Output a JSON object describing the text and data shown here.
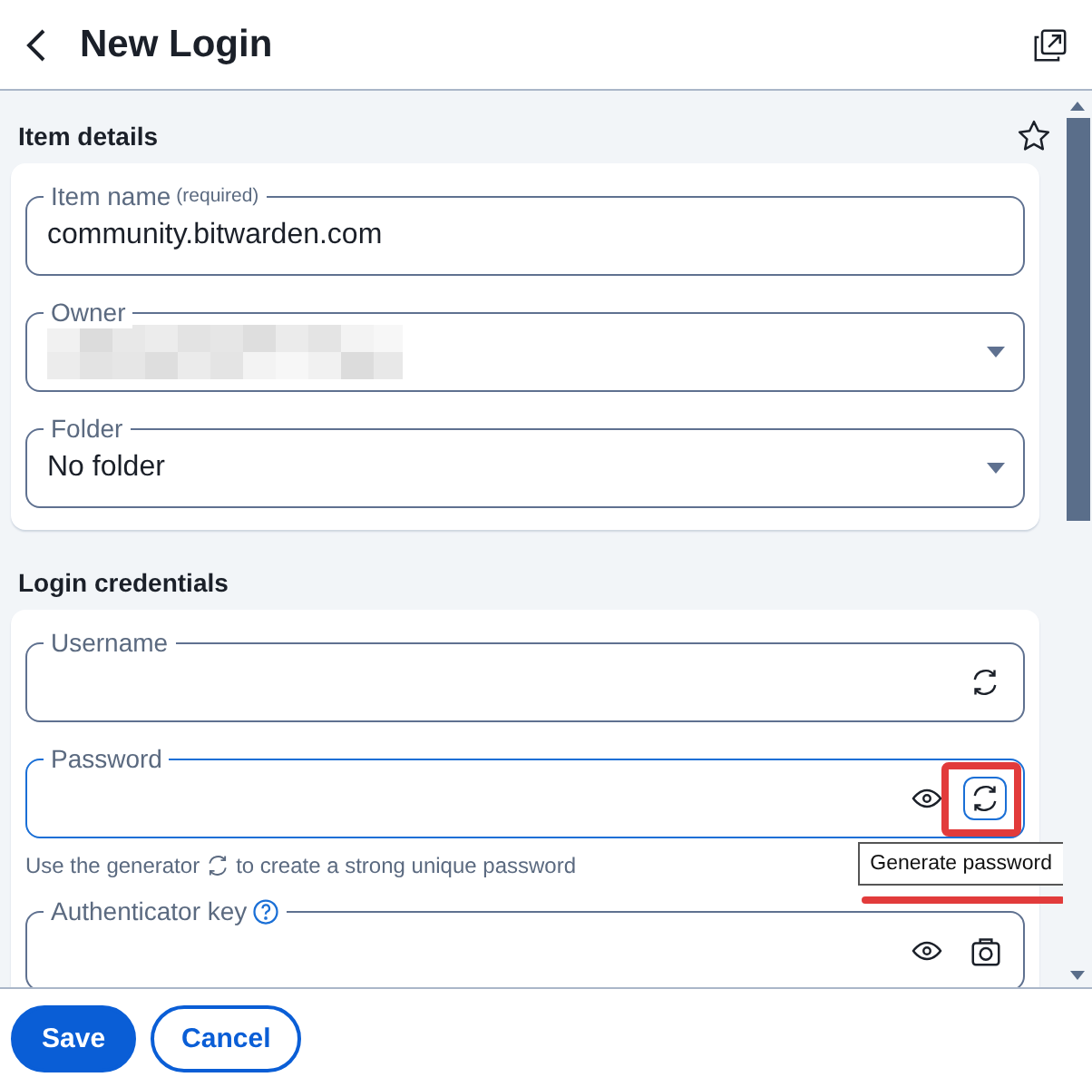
{
  "header": {
    "title": "New Login"
  },
  "sections": [
    {
      "title": "Item details",
      "favorite": false,
      "fields": [
        {
          "kind": "text",
          "label": "Item name",
          "label_note": "(required)",
          "value": "community.bitwarden.com"
        },
        {
          "kind": "select",
          "label": "Owner",
          "redacted": true
        },
        {
          "kind": "select",
          "label": "Folder",
          "value": "No folder"
        }
      ]
    },
    {
      "title": "Login credentials",
      "fields": [
        {
          "kind": "text",
          "label": "Username",
          "actions": [
            {
              "kind": "generate",
              "focused": false,
              "annotated": false
            }
          ]
        },
        {
          "kind": "text",
          "label": "Password",
          "focused": true,
          "actions": [
            {
              "kind": "reveal"
            },
            {
              "kind": "generate",
              "focused": true,
              "annotated": true
            }
          ],
          "hint_before": "Use the generator",
          "hint_after": "to create a strong unique password",
          "tooltip": {
            "text": "Generate password",
            "underlined": true
          }
        },
        {
          "kind": "text",
          "label": "Authenticator key",
          "help": true,
          "actions": [
            {
              "kind": "reveal"
            },
            {
              "kind": "camera"
            }
          ]
        }
      ]
    }
  ],
  "footer": {
    "buttons": [
      {
        "label": "Save",
        "primary": true
      },
      {
        "label": "Cancel",
        "primary": false
      }
    ]
  }
}
